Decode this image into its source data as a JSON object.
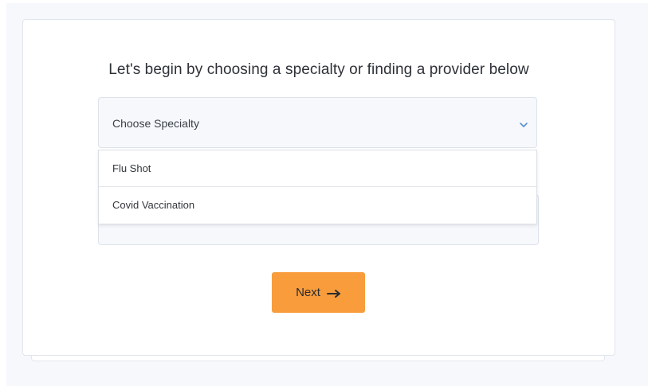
{
  "heading": "Let's begin by choosing a specialty or finding a provider below",
  "specialty_select": {
    "selected_label": "Choose Specialty",
    "icon": "chevron-down-icon"
  },
  "dropdown": {
    "options": [
      {
        "label": "Flu Shot"
      },
      {
        "label": "Covid Vaccination"
      }
    ]
  },
  "next_button": {
    "label": "Next",
    "icon": "arrow-right-icon"
  },
  "colors": {
    "accent": "#f89c3c",
    "chevron": "#5a8fd0",
    "field_bg": "#f6f8fc",
    "page_bg": "#f6f8fc"
  }
}
